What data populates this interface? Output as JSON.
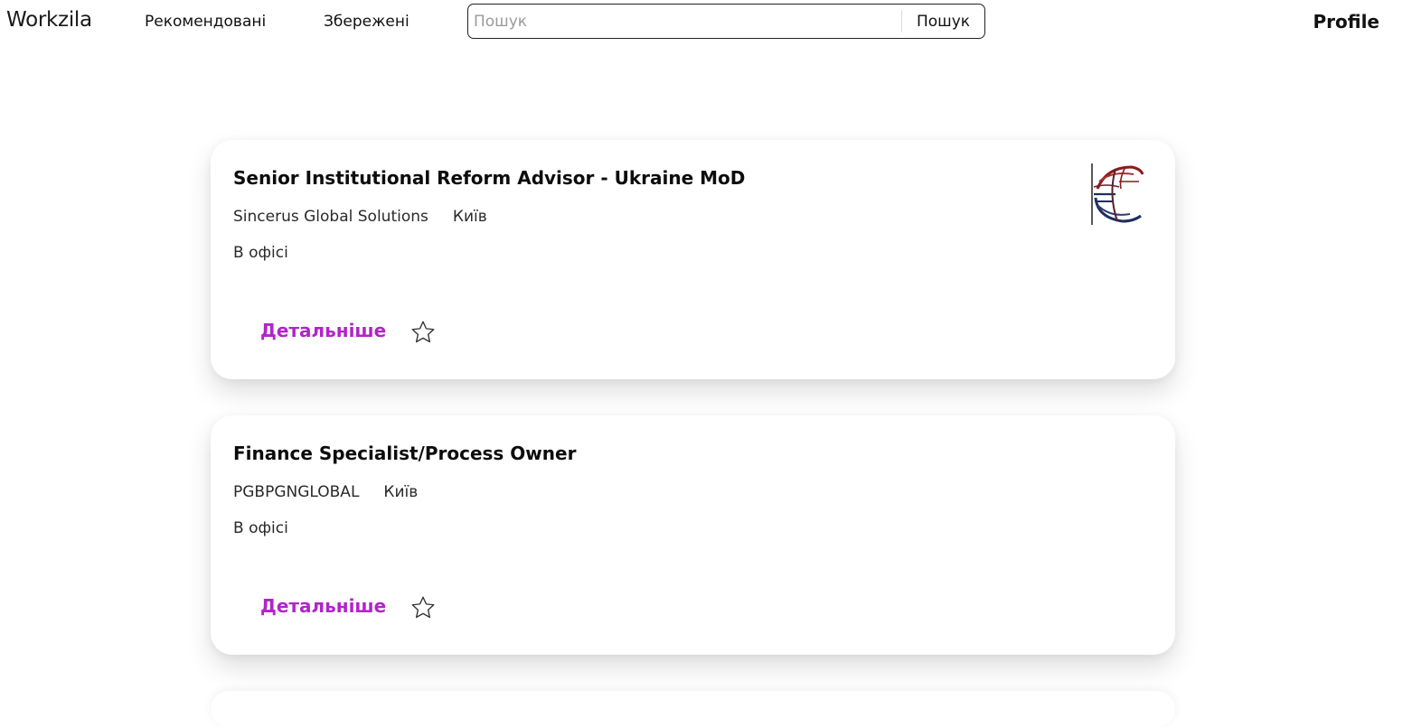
{
  "navbar": {
    "brand": "Workzila",
    "links": [
      {
        "label": "Рекомендовані"
      },
      {
        "label": "Збережені"
      }
    ],
    "search": {
      "placeholder": "Пошук",
      "value": "",
      "button_label": "Пошук"
    },
    "profile_label": "Profile"
  },
  "jobs": [
    {
      "title": "Senior Institutional Reform Advisor - Ukraine MoD",
      "company": "Sincerus Global Solutions",
      "city": "Київ",
      "work_mode": "В офісі",
      "details_label": "Детальніше",
      "has_logo": true,
      "saved": false
    },
    {
      "title": "Finance Specialist/Process Owner",
      "company": "PGBPGNGLOBAL",
      "city": "Київ",
      "work_mode": "В офісі",
      "details_label": "Детальніше",
      "has_logo": false,
      "saved": false
    }
  ],
  "colors": {
    "accent": "#b124c9",
    "logo_red": "#8b1a1a",
    "logo_navy": "#1f2f5c"
  }
}
